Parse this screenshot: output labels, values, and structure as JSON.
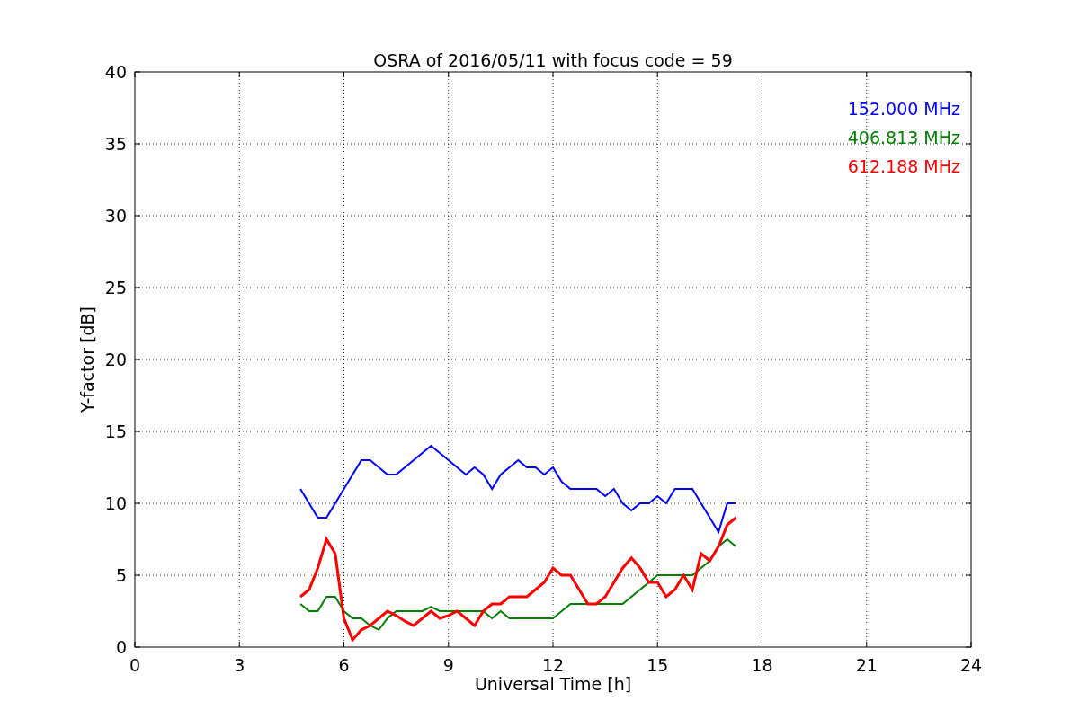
{
  "figure": {
    "chart_data": {
      "type": "line",
      "title": "OSRA of 2016/05/11 with focus code = 59",
      "xlabel": "Universal Time [h]",
      "ylabel": "Y-factor [dB]",
      "xlim": [
        0,
        24
      ],
      "ylim": [
        0,
        40
      ],
      "xticks": [
        0,
        3,
        6,
        9,
        12,
        15,
        18,
        21,
        24
      ],
      "yticks": [
        0,
        5,
        10,
        15,
        20,
        25,
        30,
        35,
        40
      ],
      "grid": true,
      "x": [
        4.75,
        5,
        5.25,
        5.5,
        5.75,
        6,
        6.25,
        6.5,
        6.75,
        7,
        7.25,
        7.5,
        7.75,
        8,
        8.25,
        8.5,
        8.75,
        9,
        9.25,
        9.5,
        9.75,
        10,
        10.25,
        10.5,
        10.75,
        11,
        11.25,
        11.5,
        11.75,
        12,
        12.25,
        12.5,
        12.75,
        13,
        13.25,
        13.5,
        13.75,
        14,
        14.25,
        14.5,
        14.75,
        15,
        15.25,
        15.5,
        15.75,
        16,
        16.25,
        16.5,
        16.75,
        17,
        17.25
      ],
      "series": [
        {
          "name": "152.000 MHz",
          "color": "#0000ff",
          "values": [
            11,
            10,
            9,
            9,
            10,
            11,
            12,
            13,
            13,
            12.5,
            12,
            12,
            12.5,
            13,
            13.5,
            14,
            13.5,
            13,
            12.5,
            12,
            12.5,
            12,
            11,
            12,
            12.5,
            13,
            12.5,
            12.5,
            12,
            12.5,
            11.5,
            11,
            11,
            11,
            11,
            10.5,
            11,
            10,
            9.5,
            10,
            10,
            10.5,
            10,
            11,
            11,
            11,
            10,
            9,
            8,
            10,
            10
          ]
        },
        {
          "name": "406.813 MHz",
          "color": "#008000",
          "values": [
            3,
            2.5,
            2.5,
            3.5,
            3.5,
            2.5,
            2,
            2,
            1.5,
            1.2,
            2,
            2.5,
            2.5,
            2.5,
            2.5,
            2.8,
            2.5,
            2.5,
            2.5,
            2.5,
            2.5,
            2.5,
            2,
            2.5,
            2,
            2,
            2,
            2,
            2,
            2,
            2.5,
            3,
            3,
            3,
            3,
            3,
            3,
            3,
            3.5,
            4,
            4.5,
            5,
            5,
            5,
            5,
            5,
            5.5,
            6,
            7,
            7.5,
            7
          ]
        },
        {
          "name": "612.188 MHz",
          "color": "#ff0000",
          "values": [
            3.5,
            4,
            5.5,
            7.5,
            6.5,
            2,
            0.5,
            1.2,
            1.5,
            2,
            2.5,
            2.2,
            1.8,
            1.5,
            2,
            2.5,
            2,
            2.2,
            2.5,
            2,
            1.5,
            2.5,
            3,
            3,
            3.5,
            3.5,
            3.5,
            4,
            4.5,
            5.5,
            5,
            5,
            4,
            3,
            3,
            3.5,
            4.5,
            5.5,
            6.2,
            5.5,
            4.5,
            4.5,
            3.5,
            4,
            5,
            4,
            6.5,
            6,
            7,
            8.5,
            9
          ]
        }
      ]
    }
  }
}
